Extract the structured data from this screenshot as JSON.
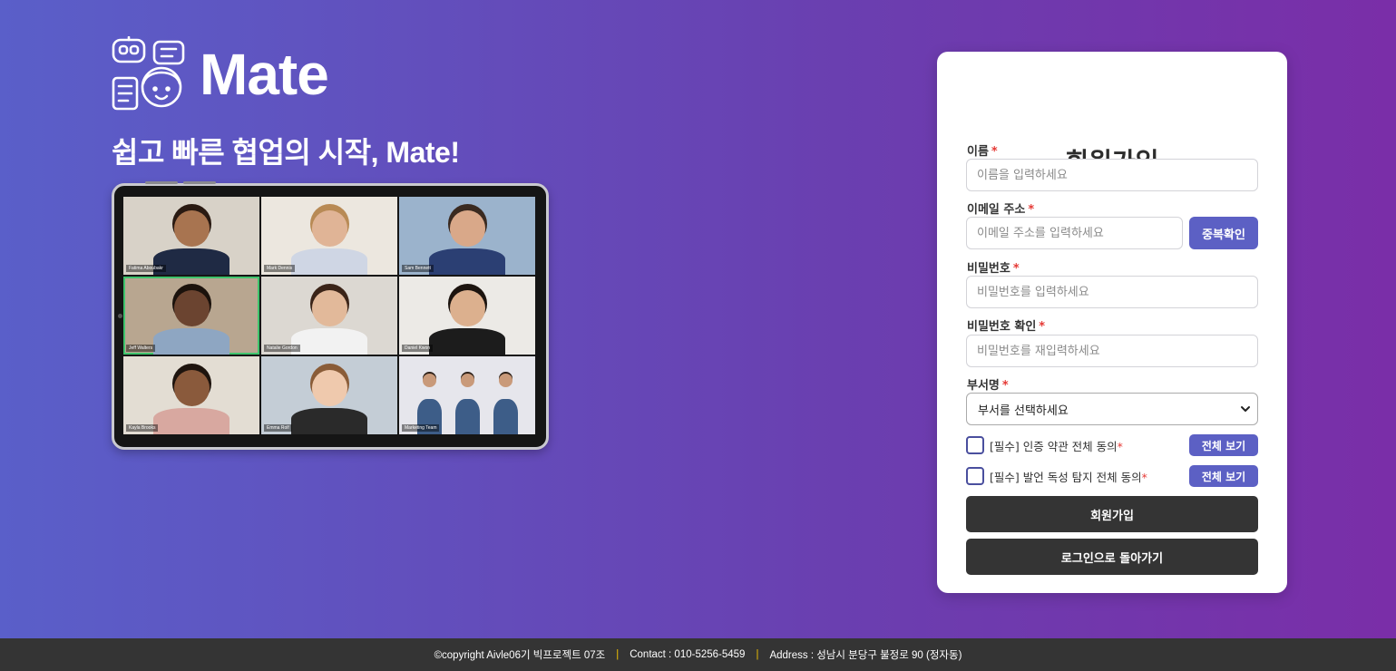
{
  "brand": {
    "name": "Mate",
    "tagline": "쉽고 빠른 협업의 시작, Mate!",
    "logo_icon": "robot-chat-logo-icon"
  },
  "hero": {
    "illustration": "video-conference-tablet",
    "participants": [
      {
        "name": "Fatima Aboubakr",
        "bg": "#d8d2c8",
        "skin": "#a87450",
        "hair": "#2a1a12",
        "shirt": "#1f2a44"
      },
      {
        "name": "Mark Dennis",
        "bg": "#ece7df",
        "skin": "#e0b496",
        "hair": "#b88a55",
        "shirt": "#cfd6e4"
      },
      {
        "name": "Sam Bennett",
        "bg": "#9bb3cc",
        "skin": "#d9a889",
        "hair": "#3a2a20",
        "shirt": "#2b3f73"
      },
      {
        "name": "Jeff Walters",
        "bg": "#b8a690",
        "skin": "#6b4430",
        "hair": "#1b120c",
        "shirt": "#8ea6c2"
      },
      {
        "name": "Natalie Gordon",
        "bg": "#dcd8d2",
        "skin": "#e2b99a",
        "hair": "#3b2418",
        "shirt": "#f2f2f2"
      },
      {
        "name": "Daniel Kwon",
        "bg": "#eceae6",
        "skin": "#dcb08e",
        "hair": "#1c140f",
        "shirt": "#1c1c1c"
      },
      {
        "name": "Kayla Brooks",
        "bg": "#e3ddd3",
        "skin": "#8a5a3c",
        "hair": "#1e140e",
        "shirt": "#d8a8a0"
      },
      {
        "name": "Emma Rolf",
        "bg": "#c4cdd6",
        "skin": "#efc9ad",
        "hair": "#8a5c38",
        "shirt": "#2a2a2a"
      },
      {
        "name": "Marketing Team",
        "bg": "#e6e6ec",
        "skin": "#c99a7a",
        "hair": "#2c2018",
        "shirt": "#3d5d88"
      }
    ]
  },
  "form": {
    "title": "회원가입",
    "required_mark": "*",
    "name": {
      "label": "이름",
      "placeholder": "이름을 입력하세요"
    },
    "email": {
      "label": "이메일 주소",
      "placeholder": "이메일 주소를 입력하세요",
      "check_button": "중복확인"
    },
    "password": {
      "label": "비밀번호",
      "placeholder": "비밀번호를 입력하세요"
    },
    "password_confirm": {
      "label": "비밀번호 확인",
      "placeholder": "비밀번호를 재입력하세요"
    },
    "department": {
      "label": "부서명",
      "selected": "부서를 선택하세요"
    },
    "agreements": [
      {
        "text": "[필수] 인증 약관 전체 동의",
        "checked": false,
        "view_button": "전체 보기"
      },
      {
        "text": "[필수] 발언 독성 탐지 전체 동의",
        "checked": false,
        "view_button": "전체 보기"
      }
    ],
    "submit_button": "회원가입",
    "back_button": "로그인으로 돌아가기"
  },
  "footer": {
    "copyright": "©copyright Aivle06기 빅프로젝트 07조",
    "contact": "Contact : 010-5256-5459",
    "address": "Address : 성남시 분당구 불정로 90 (정자동)",
    "separator": "|"
  },
  "colors": {
    "accent": "#5c60c4",
    "dark_button": "#343434",
    "required": "#e53935",
    "gradient_start": "#5a5fc9",
    "gradient_end": "#7a2ea8",
    "footer_separator": "#f0c000"
  }
}
